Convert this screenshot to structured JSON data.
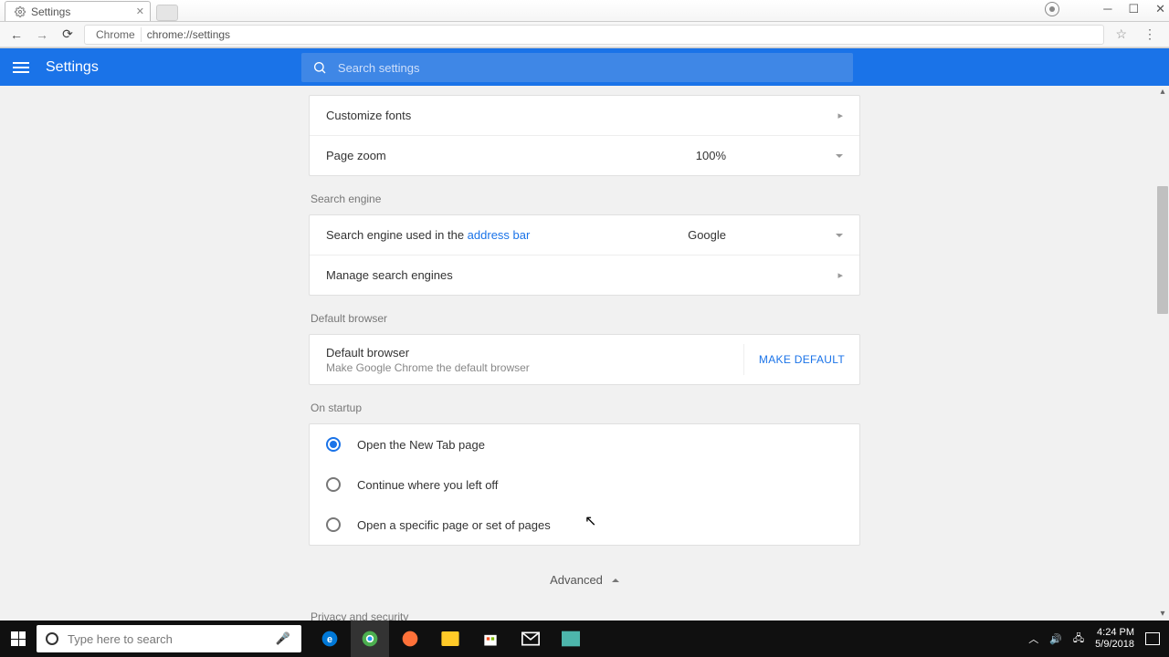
{
  "tab": {
    "title": "Settings"
  },
  "url": {
    "prefix": "Chrome",
    "path": "chrome://settings"
  },
  "header": {
    "title": "Settings",
    "search_placeholder": "Search settings"
  },
  "appearance": {
    "customize_fonts": "Customize fonts",
    "page_zoom_label": "Page zoom",
    "page_zoom_value": "100%"
  },
  "search_engine": {
    "section": "Search engine",
    "used_in_prefix": "Search engine used in the ",
    "used_in_link": "address bar",
    "value": "Google",
    "manage": "Manage search engines"
  },
  "default_browser": {
    "section": "Default browser",
    "title": "Default browser",
    "subtitle": "Make Google Chrome the default browser",
    "button": "MAKE DEFAULT"
  },
  "startup": {
    "section": "On startup",
    "options": [
      "Open the New Tab page",
      "Continue where you left off",
      "Open a specific page or set of pages"
    ],
    "selected": 0
  },
  "advanced": "Advanced",
  "privacy_section": "Privacy and security",
  "taskbar": {
    "search_placeholder": "Type here to search",
    "time": "4:24 PM",
    "date": "5/9/2018"
  }
}
